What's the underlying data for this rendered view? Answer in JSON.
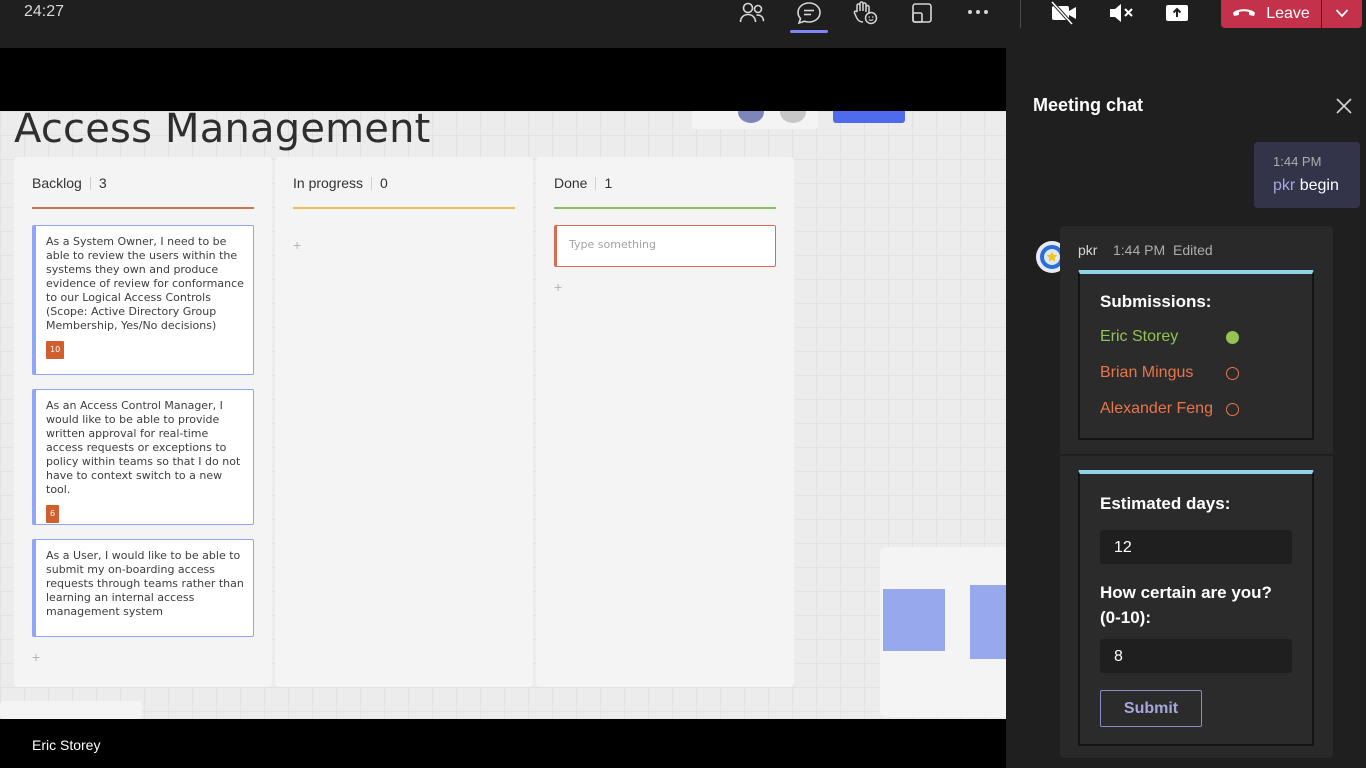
{
  "top_bar": {
    "timer": "24:27",
    "icons": [
      "people-icon",
      "chat-icon",
      "raise-hand-icon",
      "share-screen-icon",
      "more-icon",
      "camera-off-icon",
      "mic-off-icon",
      "share-tray-icon"
    ],
    "leave_label": "Leave",
    "leave_color": "#c4314b",
    "active_tab": "chat"
  },
  "board": {
    "title": "Access Management",
    "columns": [
      {
        "name": "Backlog",
        "count": "3",
        "accent": "#d8704d",
        "cards": [
          {
            "text": "As a System Owner, I need to be able to review the users within the systems they own and produce evidence of review for conformance to our Logical Access Controls (Scope: Active Directory Group Membership, Yes/No decisions)",
            "badge": "10"
          },
          {
            "text": "As an Access Control Manager, I would like to be able to provide written approval for real-time access requests or exceptions to policy within teams so that I do not have to context switch to a new tool.",
            "badge": "6"
          },
          {
            "text": "As a User, I would like to be able to submit my on-boarding access requests through teams rather than learning an internal access management system",
            "badge": ""
          }
        ]
      },
      {
        "name": "In progress",
        "count": "0",
        "accent": "#e5c15a"
      },
      {
        "name": "Done",
        "count": "1",
        "accent": "#8fbc5d",
        "input_placeholder": "Type something"
      }
    ]
  },
  "participant": {
    "name": "Eric Storey"
  },
  "chat": {
    "title": "Meeting chat",
    "my_message": {
      "time": "1:44 PM",
      "mention": "pkr",
      "text": "begin"
    },
    "message": {
      "sender": "pkr",
      "time": "1:44 PM",
      "edited": "Edited",
      "submissions": {
        "heading": "Submissions:",
        "people": [
          {
            "name": "Eric Storey",
            "color": "#92c353",
            "submitted": true
          },
          {
            "name": "Brian Mingus",
            "color": "#e97548",
            "submitted": false
          },
          {
            "name": "Alexander Feng",
            "color": "#e97548",
            "submitted": false
          }
        ]
      },
      "form": {
        "days_label": "Estimated days:",
        "days_value": "12",
        "certainty_label_1": "How certain are you?",
        "certainty_label_2": "(0-10):",
        "certainty_value": "8",
        "submit_label": "Submit"
      }
    }
  }
}
